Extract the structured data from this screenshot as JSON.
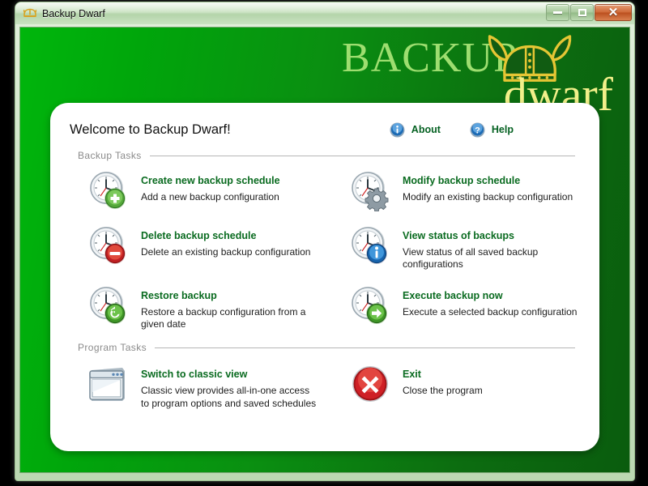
{
  "window": {
    "title": "Backup Dwarf",
    "app_icon": "viking-helmet-icon",
    "buttons": {
      "minimize": "Minimize",
      "maximize": "Maximize",
      "close": "Close"
    }
  },
  "logo": {
    "word_top": "BACKUP",
    "word_bottom": "dwarf",
    "icon": "viking-helmet-icon",
    "color_top": "#9ede70",
    "color_bottom": "#f2f08a"
  },
  "theme": {
    "background_green_light": "#00b60c",
    "background_green_dark": "#0a5c0e",
    "title_link_green": "#056122",
    "task_title_green": "#0a6b20",
    "section_label_gray": "#8b8b8b"
  },
  "panel": {
    "welcome_title": "Welcome to Backup Dwarf!",
    "links": [
      {
        "label": "About",
        "icon": "info-circle-icon"
      },
      {
        "label": "Help",
        "icon": "question-circle-icon"
      }
    ],
    "sections": [
      {
        "label": "Backup Tasks",
        "tasks": [
          {
            "title": "Create new backup schedule",
            "description": "Add a new backup configuration",
            "icon": "clock-add-icon"
          },
          {
            "title": "Modify backup schedule",
            "description": "Modify an existing backup configuration",
            "icon": "clock-gear-icon"
          },
          {
            "title": "Delete backup schedule",
            "description": "Delete an existing backup configuration",
            "icon": "clock-delete-icon"
          },
          {
            "title": "View status of backups",
            "description": "View status of all saved backup configurations",
            "icon": "clock-info-icon"
          },
          {
            "title": "Restore backup",
            "description": "Restore a backup configuration from a given date",
            "icon": "clock-restore-icon"
          },
          {
            "title": "Execute backup now",
            "description": "Execute a selected backup configuration",
            "icon": "clock-run-icon"
          }
        ]
      },
      {
        "label": "Program Tasks",
        "tasks": [
          {
            "title": "Switch to classic view",
            "description": "Classic view provides all-in-one access to program options and saved schedules",
            "icon": "window-icon"
          },
          {
            "title": "Exit",
            "description": "Close the program",
            "icon": "close-circle-icon"
          }
        ]
      }
    ]
  }
}
